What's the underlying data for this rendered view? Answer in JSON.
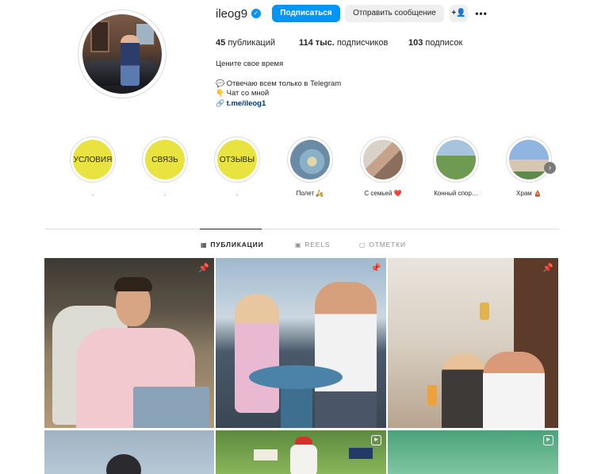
{
  "profile": {
    "username": "ileog9",
    "verified_glyph": "✓",
    "follow_label": "Подписаться",
    "message_label": "Отправить сообщение",
    "add_user_glyph": "+👤",
    "more_glyph": "•••",
    "stats": {
      "posts_num": "45",
      "posts_label": "публикаций",
      "followers_num": "114 тыс.",
      "followers_label": "подписчиков",
      "following_num": "103",
      "following_label": "подписок"
    },
    "bio": {
      "tagline": "Цените свое время",
      "line1_icon": "💬",
      "line1": "Отвечаю всем только в Telegram",
      "line2_icon": "👇",
      "line2": "Чат со мной",
      "link_icon": "🔗",
      "link": "t.me/ileog1"
    }
  },
  "highlights": [
    {
      "cover_text": "УСЛОВИЯ",
      "label": "."
    },
    {
      "cover_text": "СВЯЗЬ",
      "label": "."
    },
    {
      "cover_text": "ОТЗЫВЫ",
      "label": "."
    },
    {
      "cover_text": "",
      "label": "Полет 🛵"
    },
    {
      "cover_text": "",
      "label": "С семьей ❤️"
    },
    {
      "cover_text": "",
      "label": "Конный спор…"
    },
    {
      "cover_text": "",
      "label": "Храм 🛕"
    }
  ],
  "highlights_next_glyph": "›",
  "tabs": [
    {
      "icon": "▦",
      "label": "ПУБЛИКАЦИИ"
    },
    {
      "icon": "▣",
      "label": "REELS"
    },
    {
      "icon": "▢",
      "label": "ОТМЕТКИ"
    }
  ],
  "grid": {
    "pin_glyph": "📌",
    "reel_glyph": "▶"
  },
  "colors": {
    "accent": "#0095f6",
    "link": "#00376b",
    "highlight_yellow": "#e9e342"
  }
}
